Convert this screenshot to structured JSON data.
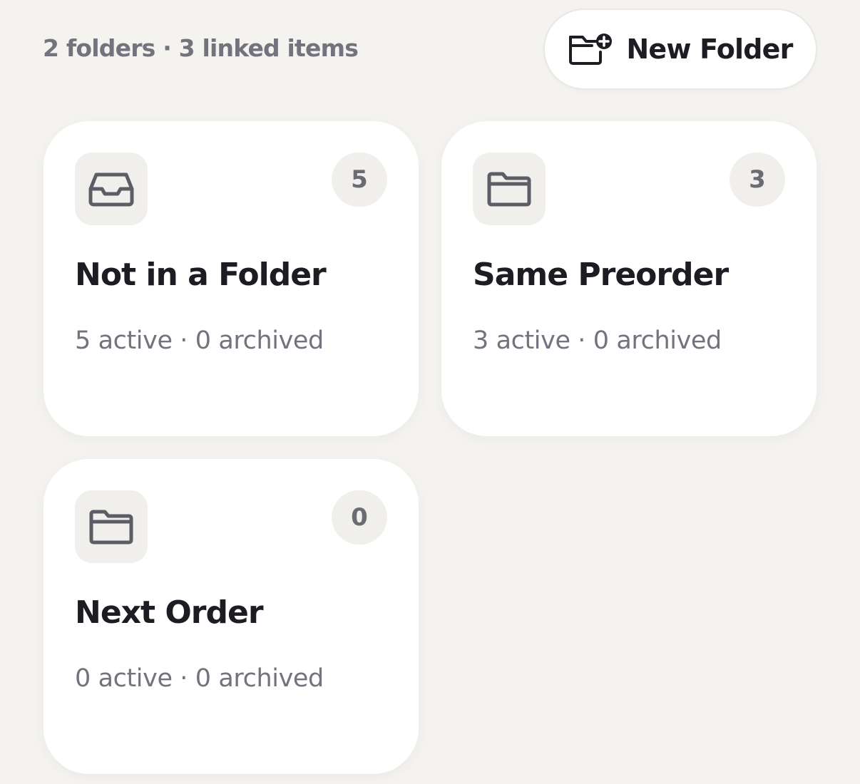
{
  "header": {
    "summary": "2 folders · 3 linked items",
    "new_folder_label": "New Folder",
    "new_folder_icon": "folder-plus-icon"
  },
  "colors": {
    "background": "#f4f3f0",
    "card": "#ffffff",
    "tile": "#f0efec",
    "muted_text": "#73737d",
    "primary_text": "#1c1c22"
  },
  "folders": [
    {
      "title": "Not in a Folder",
      "count": "5",
      "meta": "5 active · 0 archived",
      "icon": "inbox-icon"
    },
    {
      "title": "Same Preorder",
      "count": "3",
      "meta": "3 active · 0 archived",
      "icon": "folder-icon"
    },
    {
      "title": "Next Order",
      "count": "0",
      "meta": "0 active · 0 archived",
      "icon": "folder-icon"
    }
  ]
}
